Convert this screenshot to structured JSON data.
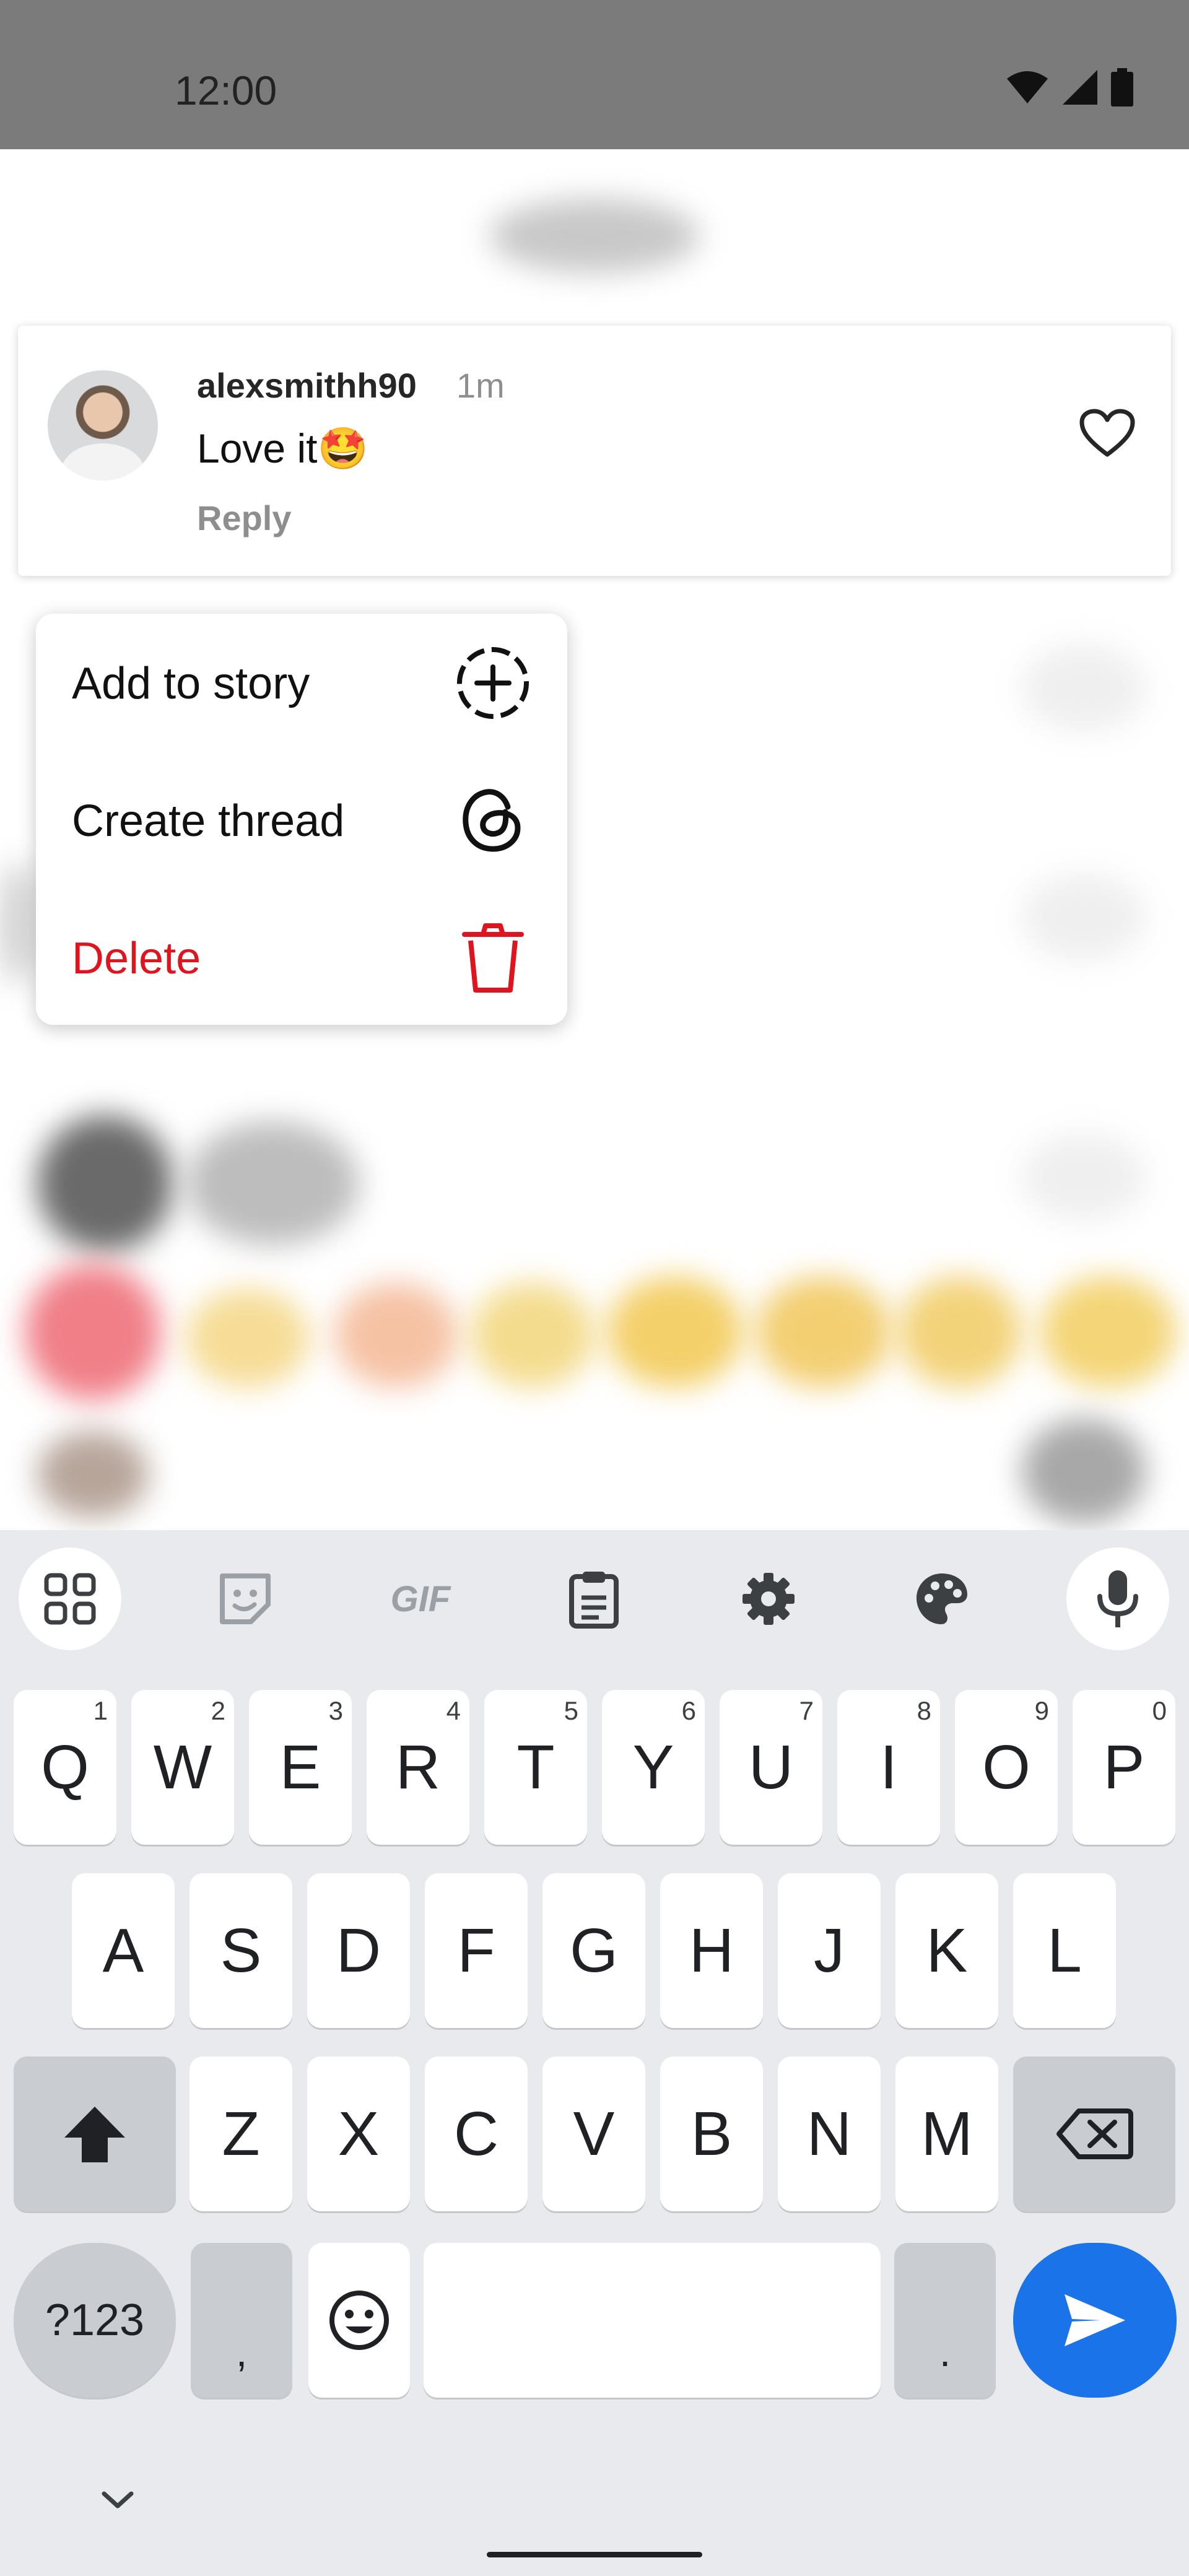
{
  "status_bar": {
    "time": "12:00",
    "icons": [
      "wifi-icon",
      "signal-icon",
      "battery-icon"
    ]
  },
  "comment": {
    "username": "alexsmithh90",
    "time_ago": "1m",
    "text": "Love it🤩",
    "reply_label": "Reply",
    "like_icon": "heart-icon"
  },
  "context_menu": {
    "items": [
      {
        "label": "Add to story",
        "icon": "add-to-story-icon"
      },
      {
        "label": "Create thread",
        "icon": "threads-icon"
      },
      {
        "label": "Delete",
        "icon": "trash-icon",
        "color": "#e0141e"
      }
    ]
  },
  "keyboard": {
    "toolbar": [
      "apps-grid-icon",
      "sticker-icon",
      "gif-icon",
      "clipboard-icon",
      "settings-icon",
      "palette-icon",
      "mic-icon"
    ],
    "gif_label": "GIF",
    "row1": [
      {
        "key": "Q",
        "hint": "1"
      },
      {
        "key": "W",
        "hint": "2"
      },
      {
        "key": "E",
        "hint": "3"
      },
      {
        "key": "R",
        "hint": "4"
      },
      {
        "key": "T",
        "hint": "5"
      },
      {
        "key": "Y",
        "hint": "6"
      },
      {
        "key": "U",
        "hint": "7"
      },
      {
        "key": "I",
        "hint": "8"
      },
      {
        "key": "O",
        "hint": "9"
      },
      {
        "key": "P",
        "hint": "0"
      }
    ],
    "row2": [
      "A",
      "S",
      "D",
      "F",
      "G",
      "H",
      "J",
      "K",
      "L"
    ],
    "row3": [
      "Z",
      "X",
      "C",
      "V",
      "B",
      "N",
      "M"
    ],
    "symbols_label": "?123",
    "comma_label": ",",
    "period_label": ".",
    "accent_color": "#1a73e8"
  }
}
